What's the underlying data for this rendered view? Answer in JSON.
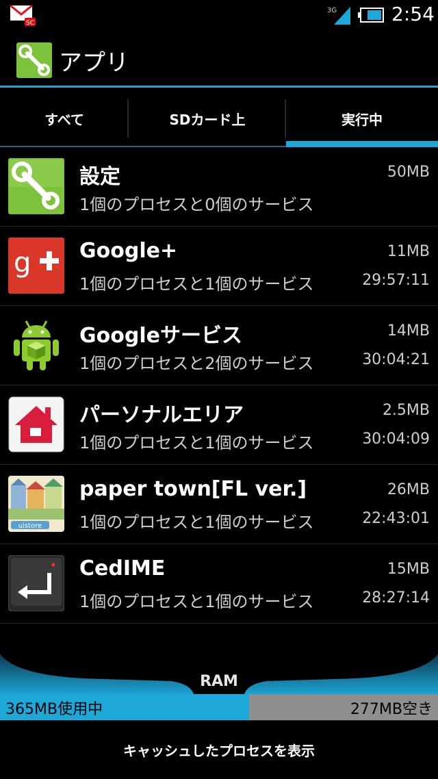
{
  "status_bar": {
    "time": "2:54",
    "network": "3G",
    "icons": [
      "mail-icon",
      "signal-icon",
      "battery-icon"
    ]
  },
  "action_bar": {
    "title": "アプリ",
    "icon": "wrench-icon"
  },
  "tabs": [
    {
      "label": "すべて",
      "active": false
    },
    {
      "label": "SDカード上",
      "active": false
    },
    {
      "label": "実行中",
      "active": true
    }
  ],
  "apps": [
    {
      "name": "設定",
      "desc": "1個のプロセスと0個のサービス",
      "size": "50MB",
      "time": "",
      "icon": "settings-icon"
    },
    {
      "name": "Google+",
      "desc": "1個のプロセスと1個のサービス",
      "size": "11MB",
      "time": "29:57:11",
      "icon": "google-plus-icon"
    },
    {
      "name": "Googleサービス",
      "desc": "1個のプロセスと2個のサービス",
      "size": "14MB",
      "time": "30:04:21",
      "icon": "android-icon"
    },
    {
      "name": "パーソナルエリア",
      "desc": "1個のプロセスと1個のサービス",
      "size": "2.5MB",
      "time": "30:04:09",
      "icon": "home-icon"
    },
    {
      "name": "paper town[FL ver.]",
      "desc": "1個のプロセスと1個のサービス",
      "size": "26MB",
      "time": "22:43:01",
      "icon": "paper-town-icon"
    },
    {
      "name": "CedIME",
      "desc": "1個のプロセスと1個のサービス",
      "size": "15MB",
      "time": "28:27:14",
      "icon": "enter-key-icon"
    }
  ],
  "ram": {
    "label": "RAM",
    "used": "365MB使用中",
    "free": "277MB空き",
    "used_fraction": 0.568
  },
  "bottom_button": "キャッシュしたプロセスを表示",
  "colors": {
    "accent": "#1ea8d8",
    "background": "#000000",
    "free_bar": "#8f8f8f"
  }
}
